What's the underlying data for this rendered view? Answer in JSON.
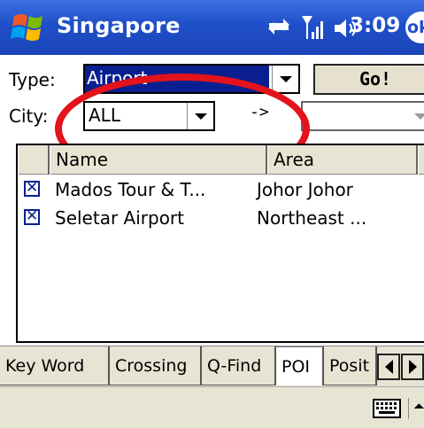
{
  "titlebar": {
    "title": "Singapore",
    "time": "3:09",
    "ok_label": "ok",
    "icons": [
      "windows-start-icon",
      "sync-icon",
      "signal-icon",
      "volume-icon"
    ]
  },
  "form": {
    "type_label": "Type:",
    "type_value": "Airport",
    "go_label": "Go!",
    "city_label": "City:",
    "city_value": "ALL",
    "arrow_text": "->",
    "dest_value": ""
  },
  "list": {
    "columns": [
      "",
      "Name",
      "Area",
      ""
    ],
    "rows": [
      {
        "checked": true,
        "name": "Mados Tour & T...",
        "area": "Johor Johor"
      },
      {
        "checked": true,
        "name": "Seletar Airport",
        "area": "Northeast ..."
      }
    ]
  },
  "tabs": {
    "items": [
      "Key Word",
      "Crossing",
      "Q-Find",
      "POI",
      "Posit"
    ],
    "active": "POI"
  },
  "colors": {
    "titlebar": "#1f4fc9",
    "selection": "#0a1f8f",
    "highlight_ring": "#e4121b",
    "chrome": "#e8e4d4"
  }
}
